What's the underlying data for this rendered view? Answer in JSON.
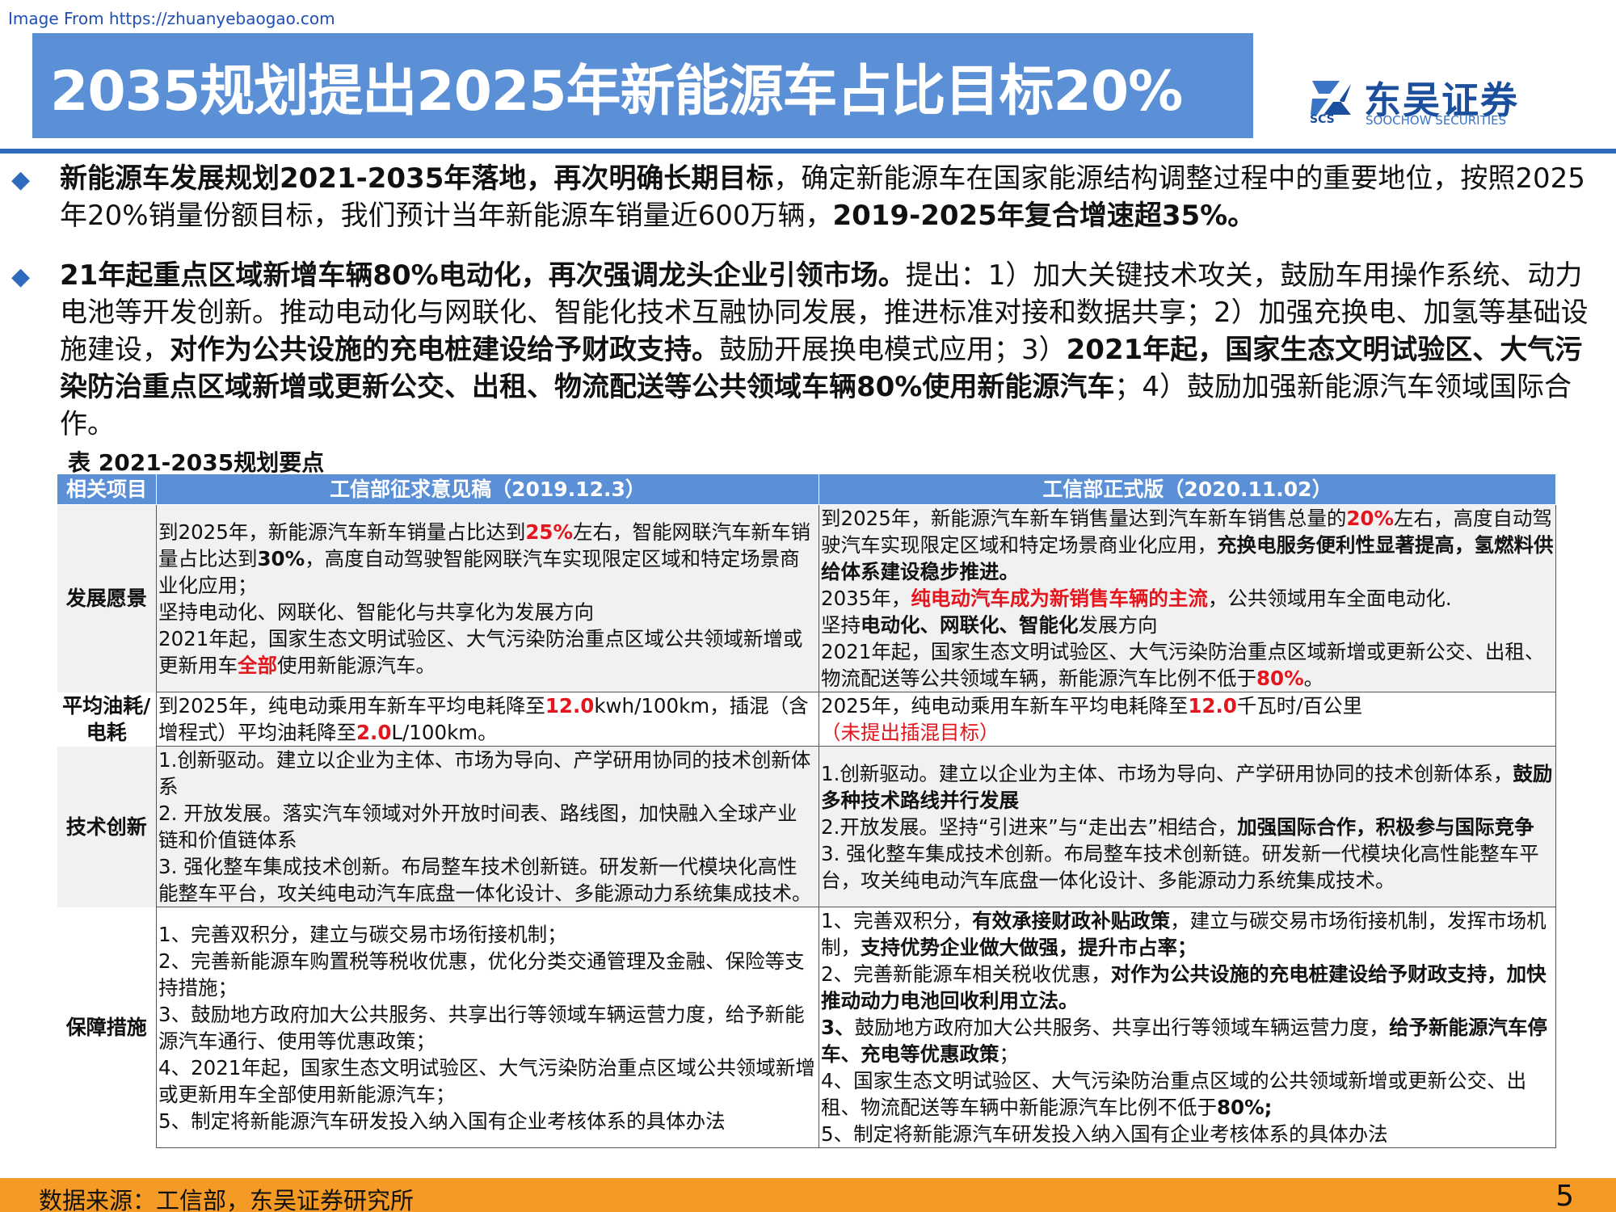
{
  "source_url": "Image From https://zhuanyebaogao.com",
  "title": "2035规划提出2025年新能源车占比目标20%",
  "logo": {
    "name_cn": "东吴证券",
    "name_en": "SOOCHOW SECURITIES",
    "abbr": "SCS"
  },
  "bullets": [
    {
      "bold1": "新能源车发展规划2021-2035年落地，再次明确长期目标",
      "text1": "，确定新能源车在国家能源结构调整过程中的重要地位，按照2025年20%销量份额目标，我们预计当年新能源车销量近600万辆，",
      "bold2": "2019-2025年复合增速超35%。"
    },
    {
      "bold1": "21年起重点区域新增车辆80%电动化，再次强调龙头企业引领市场。",
      "text1": "提出：1）加大关键技术攻关，鼓励车用操作系统、动力电池等开发创新。推动电动化与网联化、智能化技术互融协同发展，推进标准对接和数据共享；2）加强充换电、加氢等基础设施建设，",
      "bold2": "对作为公共设施的充电桩建设给予财政支持。",
      "text2": "鼓励开展换电模式应用；3）",
      "bold3": "2021年起，国家生态文明试验区、大气污染防治重点区域新增或更新公交、出租、物流配送等公共领域车辆80%使用新能源汽车",
      "text3": "；4）鼓励加强新能源汽车领域国际合作。"
    }
  ],
  "table": {
    "caption": "表  2021-2035规划要点",
    "headers": [
      "相关项目",
      "工信部征求意见稿（2019.12.3）",
      "工信部正式版（2020.11.02）"
    ],
    "rows": [
      {
        "label": "发展愿景",
        "draft": {
          "l1a": "到2025年，新能源汽车新车销量占比达到",
          "l1r": "25%",
          "l1b": "左右，智能网联汽车新车销量占比达到",
          "l1k": "30%",
          "l1c": "，高度自动驾驶智能网联汽车实现限定区域和特定场景商业化应用；",
          "l2": "坚持电动化、网联化、智能化与共享化为发展方向",
          "l3a": "2021年起，国家生态文明试验区、大气污染防治重点区域公共领域新增或更新用车",
          "l3r": "全部",
          "l3b": "使用新能源汽车。"
        },
        "final": {
          "l1a": "到2025年，新能源汽车新车销售量达到汽车新车销售总量的",
          "l1r": "20%",
          "l1b": "左右，高度自动驾驶汽车实现限定区域和特定场景商业化应用，",
          "l1k": "充换电服务便利性显著提高，氢燃料供给体系建设稳步推进。",
          "l2a": "2035年，",
          "l2r": "纯电动汽车成为新销售车辆的主流",
          "l2b": "，公共领域用车全面电动化.",
          "l3a": "坚持",
          "l3k": "电动化、网联化、智能化",
          "l3b": "发展方向",
          "l4a": "2021年起，国家生态文明试验区、大气污染防治重点区域新增或更新公交、出租、物流配送等公共领域车辆，新能源汽车比例不低于",
          "l4r": "80%",
          "l4b": "。"
        }
      },
      {
        "label": "平均油耗/电耗",
        "draft": {
          "a": "到2025年，纯电动乘用车新车平均电耗降至",
          "r1": "12.0",
          "b": "kwh/100km，插混（含增程式）平均油耗降至",
          "r2": "2.0",
          "c": "L/100km。"
        },
        "final": {
          "a": "2025年，纯电动乘用车新车平均电耗降至",
          "r1": "12.0",
          "b": "千瓦时/百公里",
          "note": "（未提出插混目标）"
        }
      },
      {
        "label": "技术创新",
        "draft": {
          "l1": "1.创新驱动。建立以企业为主体、市场为导向、产学研用协同的技术创新体系",
          "l2": "2. 开放发展。落实汽车领域对外开放时间表、路线图，加快融入全球产业链和价值链体系",
          "l3": "3. 强化整车集成技术创新。布局整车技术创新链。研发新一代模块化高性能整车平台，攻关纯电动汽车底盘一体化设计、多能源动力系统集成技术。"
        },
        "final": {
          "l1a": "1.创新驱动。建立以企业为主体、市场为导向、产学研用协同的技术创新体系，",
          "l1k": "鼓励多种技术路线并行发展",
          "l2a": "2.开放发展。坚持“引进来”与“走出去”相结合，",
          "l2k": "加强国际合作，积极参与国际竞争",
          "l3": "3. 强化整车集成技术创新。布局整车技术创新链。研发新一代模块化高性能整车平台，攻关纯电动汽车底盘一体化设计、多能源动力系统集成技术。"
        }
      },
      {
        "label": "保障措施",
        "draft": {
          "l1": "1、完善双积分，建立与碳交易市场衔接机制；",
          "l2": "2、完善新能源车购置税等税收优惠，优化分类交通管理及金融、保险等支持措施；",
          "l3": "3、鼓励地方政府加大公共服务、共享出行等领域车辆运营力度，给予新能源汽车通行、使用等优惠政策；",
          "l4": "4、2021年起，国家生态文明试验区、大气污染防治重点区域公共领域新增或更新用车全部使用新能源汽车；",
          "l5": "5、制定将新能源汽车研发投入纳入国有企业考核体系的具体办法"
        },
        "final": {
          "l1a": "1、完善双积分，",
          "l1k": "有效承接财政补贴政策",
          "l1b": "，建立与碳交易市场衔接机制，发挥市场机制，",
          "l1k2": "支持优势企业做大做强，提升市占率；",
          "l2a": "2、完善新能源车相关税收优惠，",
          "l2k": "对作为公共设施的充电桩建设给予财政支持，加快推动动力电池回收利用立法。",
          "l3k": "3、",
          "l3a": "鼓励地方政府加大公共服务、共享出行等领域车辆运营力度，",
          "l3k2": "给予新能源汽车停车、充电等优惠政策",
          "l3b": "；",
          "l4a": "4、国家生态文明试验区、大气污染防治重点区域的公共领域新增或更新公交、出租、物流配送等车辆中新能源汽车比例不低于",
          "l4k": "80%;",
          "l5": "5、制定将新能源汽车研发投入纳入国有企业考核体系的具体办法"
        }
      }
    ]
  },
  "footer": {
    "source": "数据来源：工信部，东吴证券研究所",
    "page": "5"
  },
  "colors": {
    "title_band": "#5b8fd6",
    "rule": "#2f6bbd",
    "footer": "#f49a25",
    "highlight_red": "#e3161d",
    "logo_blue": "#1b4e9c"
  }
}
